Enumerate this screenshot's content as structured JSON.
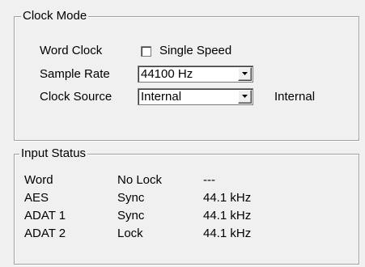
{
  "clock_mode": {
    "title": "Clock Mode",
    "word_clock_label": "Word Clock",
    "single_speed_label": "Single Speed",
    "single_speed_checked": false,
    "sample_rate_label": "Sample Rate",
    "sample_rate_value": "44100 Hz",
    "clock_source_label": "Clock Source",
    "clock_source_value": "Internal",
    "clock_source_status": "Internal"
  },
  "input_status": {
    "title": "Input Status",
    "rows": [
      {
        "name": "Word",
        "state": "No Lock",
        "freq": "---"
      },
      {
        "name": "AES",
        "state": "Sync",
        "freq": "44.1 kHz"
      },
      {
        "name": "ADAT 1",
        "state": "Sync",
        "freq": "44.1 kHz"
      },
      {
        "name": "ADAT 2",
        "state": "Lock",
        "freq": "44.1 kHz"
      }
    ]
  },
  "icons": {
    "dropdown": "chevron-down-icon"
  }
}
